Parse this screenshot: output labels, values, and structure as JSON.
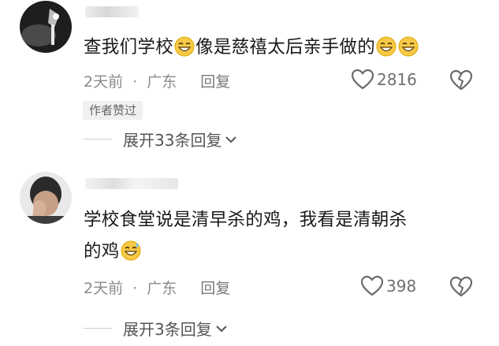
{
  "comments": [
    {
      "text_before": "查我们学校",
      "text_middle": "像是慈禧太后亲手做的",
      "time": "2天前",
      "location": "广东",
      "reply_label": "回复",
      "likes": "2816",
      "badge": "作者赞过",
      "expand_label": "展开33条回复"
    },
    {
      "text_line1": "学校食堂说是清早杀的鸡，我看是清朝杀",
      "text_line2": "的鸡",
      "time": "2天前",
      "location": "广东",
      "reply_label": "回复",
      "likes": "398",
      "expand_label": "展开3条回复"
    }
  ],
  "separator": "·",
  "icons": {
    "emoji": "grinning-face-emoji",
    "emoji2": "laughing-sweat-emoji",
    "like": "heart-outline-icon",
    "dislike": "broken-heart-icon",
    "expand": "chevron-down-icon"
  },
  "colors": {
    "meta_text": "#8a8a8a",
    "badge_bg": "#f0f0f0",
    "emoji_yellow": "#f7c948"
  }
}
